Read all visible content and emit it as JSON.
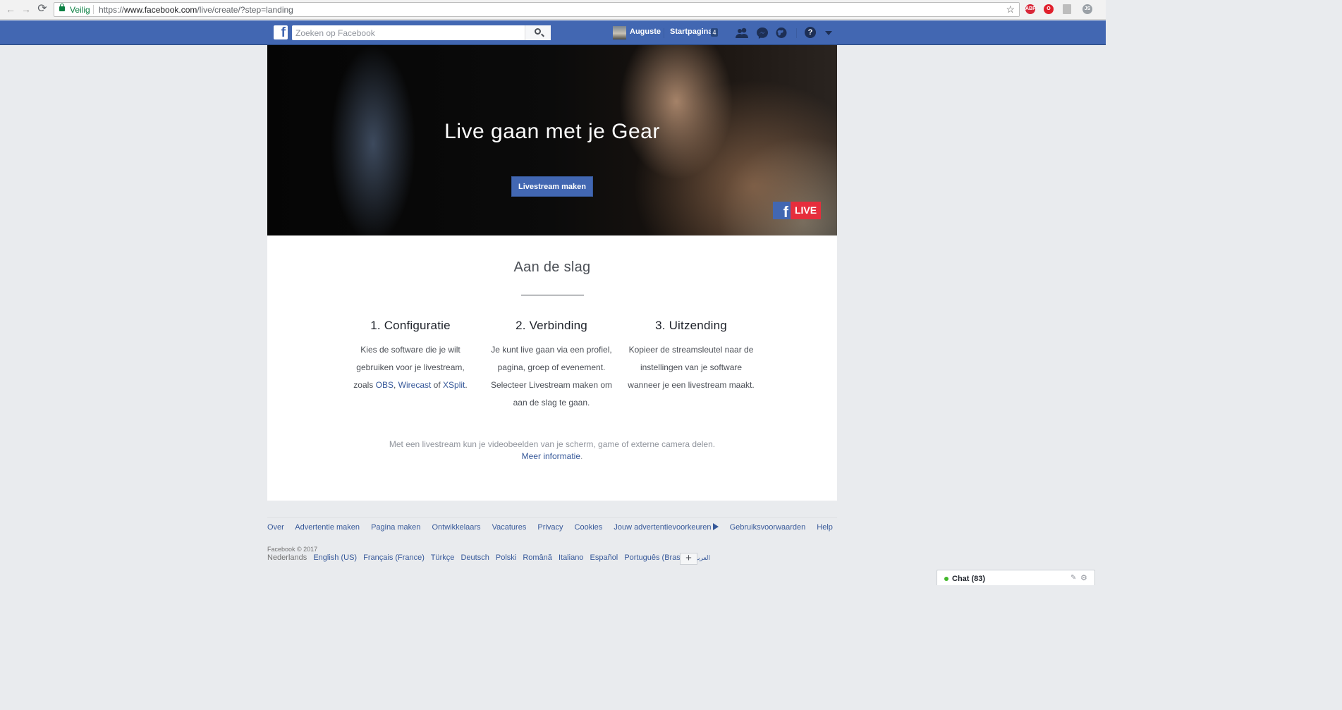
{
  "browser": {
    "back_glyph": "←",
    "forward_glyph": "→",
    "reload_glyph": "⟳",
    "secure_label": "Veilig",
    "url_scheme": "https://",
    "url_host": "www.facebook.com",
    "url_path": "/live/create/?step=landing",
    "star_glyph": "☆",
    "extensions": [
      {
        "name": "adblock-plus-icon",
        "label": "ABP",
        "color": "#d8283a"
      },
      {
        "name": "opera-icon",
        "label": "O",
        "color": "#e0202c"
      },
      {
        "name": "page-icon",
        "label": "",
        "color": "#bdbdbd"
      },
      {
        "name": "js-icon",
        "label": "JS",
        "color": "#9aa0a6"
      }
    ]
  },
  "topbar": {
    "logo": "f",
    "search_placeholder": "Zoeken op Facebook",
    "user_name": "Auguste",
    "home_label": "Startpagina",
    "home_count": "4",
    "help_glyph": "?",
    "colors": {
      "bar": "#4267b2",
      "link": "#365899"
    }
  },
  "hero": {
    "title": "Live gaan met je Gear",
    "button_label": "Livestream maken",
    "badge_f": "f",
    "badge_live": "LIVE"
  },
  "getting_started": {
    "title": "Aan de slag",
    "steps": [
      {
        "title": "1. Configuratie",
        "text_before": "Kies de software die je wilt gebruiken voor je livestream, zoals ",
        "link1": "OBS",
        "sep1": ", ",
        "link2": "Wirecast",
        "sep2": " of ",
        "link3": "XSplit",
        "text_after": "."
      },
      {
        "title": "2. Verbinding",
        "text": "Je kunt live gaan via een profiel, pagina, groep of evenement. Selecteer Livestream maken om aan de slag te gaan."
      },
      {
        "title": "3. Uitzending",
        "text": "Kopieer de streamsleutel naar de instellingen van je software wanneer je een livestream maakt."
      }
    ],
    "info_text": "Met een livestream kun je videobeelden van je scherm, game of externe camera delen.",
    "more_info": "Meer informatie",
    "more_info_period": "."
  },
  "footer": {
    "links": [
      "Over",
      "Advertentie maken",
      "Pagina maken",
      "Ontwikkelaars",
      "Vacatures",
      "Privacy",
      "Cookies",
      "Jouw advertentievoorkeuren",
      "Gebruiksvoorwaarden",
      "Help"
    ],
    "copyright": "Facebook © 2017",
    "current_language": "Nederlands",
    "languages": [
      "English (US)",
      "Français (France)",
      "Türkçe",
      "Deutsch",
      "Polski",
      "Română",
      "Italiano",
      "Español",
      "Português (Brasil)",
      "العربية"
    ],
    "more_languages": "+"
  },
  "chat": {
    "label": "Chat (83)",
    "compose_glyph": "✎",
    "settings_glyph": "⚙"
  }
}
